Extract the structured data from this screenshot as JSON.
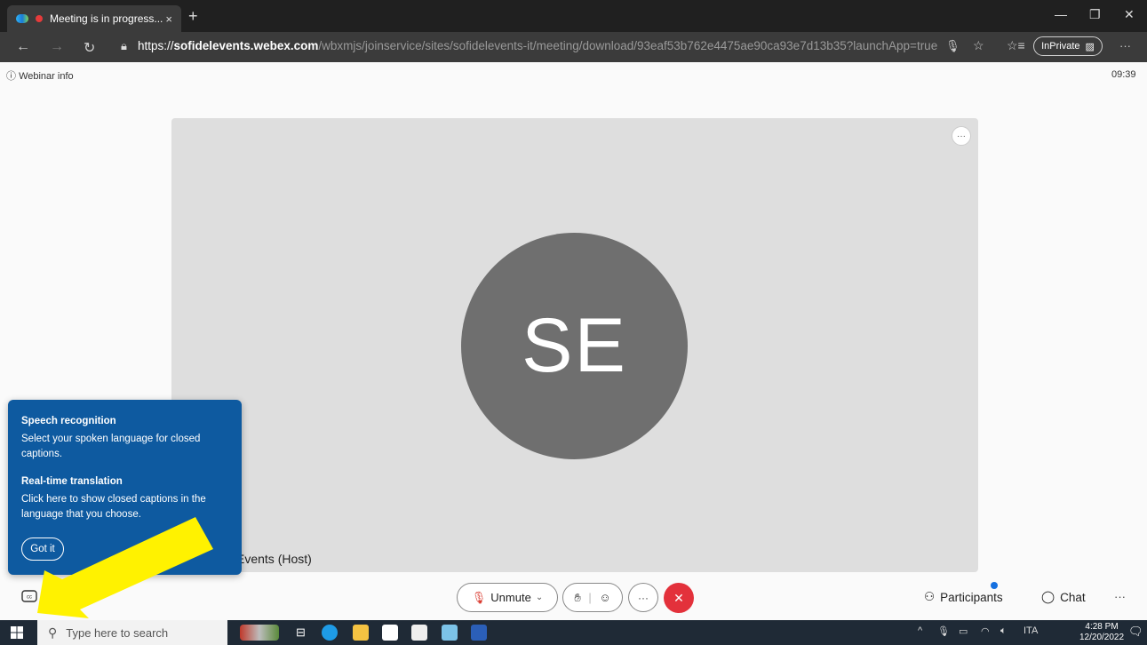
{
  "browser": {
    "tab_title": "Meeting is in progress...",
    "tab_close": "×",
    "new_tab": "+",
    "url_proto": "https://",
    "url_host": "sofidelevents.webex.com",
    "url_path": "/wbxmjs/joinservice/sites/sofidelevents-it/meeting/download/93eaf53b762e4475ae90ca93e7d13b35?launchApp=true",
    "inprivate_label": "InPrivate",
    "more": "···"
  },
  "meeting": {
    "webinar_info": "Webinar info",
    "clock": "09:39",
    "avatar_initials": "SE",
    "host_label": "Events (Host)",
    "stage_more": "···"
  },
  "tooltip": {
    "title1": "Speech recognition",
    "text1": "Select your spoken language for closed captions.",
    "title2": "Real-time translation",
    "text2": "Click here to show closed captions in the language that you choose.",
    "button": "Got it"
  },
  "controls": {
    "unmute": "Unmute",
    "participants": "Participants",
    "chat": "Chat",
    "more": "···"
  },
  "taskbar": {
    "search_placeholder": "Type here to search",
    "lang": "ITA",
    "time": "4:28 PM",
    "date": "12/20/2022"
  },
  "colors": {
    "tooltip_bg": "#0e5aa0",
    "end_call": "#e3313b",
    "arrow": "#fff200",
    "avatar": "#6f6f6f"
  }
}
